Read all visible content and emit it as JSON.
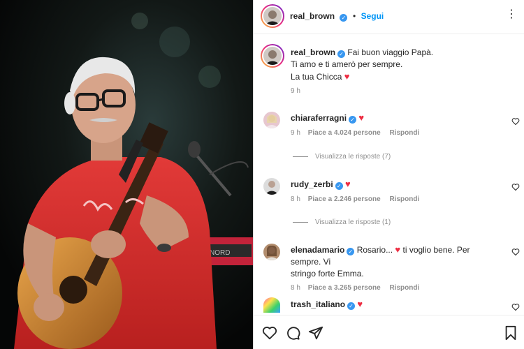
{
  "post": {
    "username": "real_brown",
    "follow_label": "Segui",
    "dot": "•",
    "more_icon": "more-horizontal-icon"
  },
  "caption": {
    "username": "real_brown",
    "line1": "Fai buon viaggio Papà.",
    "line2": "Ti amo e ti amerò per sempre.",
    "line3": "La tua Chicca",
    "time": "9 h"
  },
  "comments": [
    {
      "username": "chiaraferragni",
      "text": "",
      "time": "9 h",
      "likes": "Piace a 4.024 persone",
      "reply": "Rispondi",
      "view_replies": "Visualizza le risposte (7)"
    },
    {
      "username": "rudy_zerbi",
      "text": "",
      "time": "8 h",
      "likes": "Piace a 2.246 persone",
      "reply": "Rispondi",
      "view_replies": "Visualizza le risposte (1)"
    },
    {
      "username": "elenadamario",
      "text_a": "Rosario...",
      "text_b": "ti voglio bene. Per sempre. Vi",
      "text_c": "stringo forte Emma.",
      "time": "8 h",
      "likes": "Piace a 3.265 persone",
      "reply": "Rispondi"
    },
    {
      "username": "trash_italiano",
      "text": ""
    }
  ],
  "colors": {
    "verified": "#3897f0",
    "follow": "#0095f6",
    "heart": "#ed2d42"
  }
}
